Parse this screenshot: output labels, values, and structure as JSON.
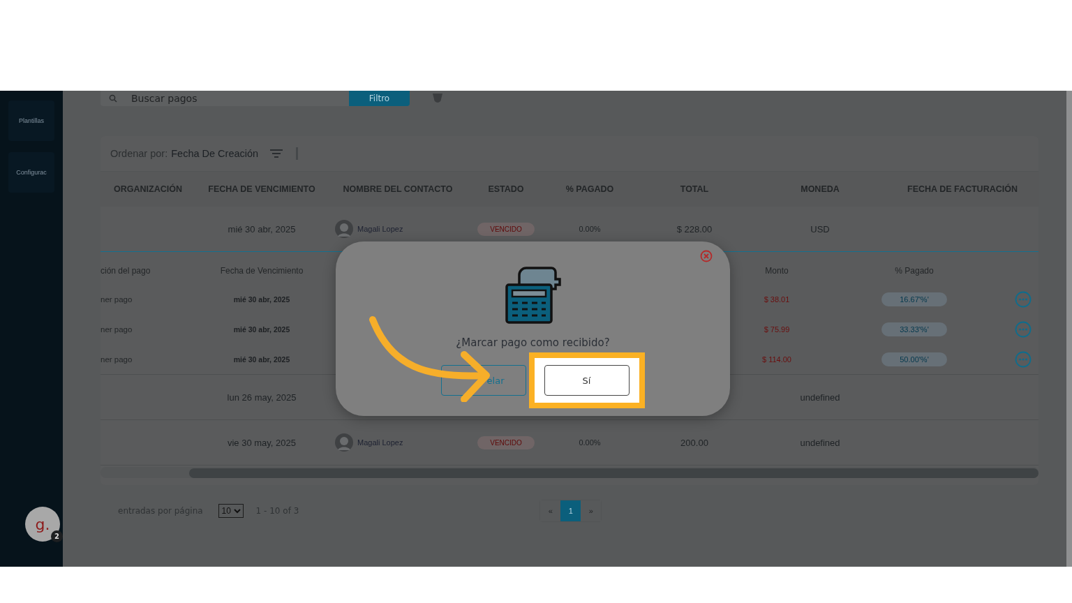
{
  "sidebar": {
    "items": [
      {
        "label": "Plantillas"
      },
      {
        "label": "Configurac"
      }
    ],
    "account": {
      "initial": "g.",
      "badge": "2"
    }
  },
  "toolbar": {
    "search": {
      "placeholder": "Buscar pagos"
    },
    "filter_button": "Filtro"
  },
  "sort": {
    "label": "Ordenar por:",
    "value": "Fecha De Creación"
  },
  "table": {
    "columns": [
      "ORGANIZACIÓN",
      "FECHA DE VENCIMIENTO",
      "NOMBRE DEL CONTACTO",
      "ESTADO",
      "% PAGADO",
      "TOTAL",
      "MONEDA",
      "FECHA DE FACTURACIÓN"
    ],
    "rows": [
      {
        "due": "mié 30 abr, 2025",
        "contact": "Magali Lopez",
        "status": "VENCIDO",
        "paid": "0.00%",
        "total": "$ 228.00",
        "currency": "USD",
        "expanded": true,
        "payments": {
          "columns": [
            "ción del pago",
            "Fecha de Vencimiento",
            "Monto",
            "% Pagado"
          ],
          "rows": [
            {
              "description": "ner pago",
              "due": "mié 30 abr, 2025",
              "amount": "$ 38.01",
              "percent": "16.67'%'"
            },
            {
              "description": "ner pago",
              "due": "mié 30 abr, 2025",
              "amount": "$ 75.99",
              "percent": "33.33'%'"
            },
            {
              "description": "ner pago",
              "due": "mié 30 abr, 2025",
              "amount": "$ 114.00",
              "percent": "50.00'%'"
            }
          ]
        }
      },
      {
        "due": "lun 26 may, 2025",
        "currency": "undefined",
        "expanded": false
      },
      {
        "due": "vie 30 may, 2025",
        "contact": "Magali Lopez",
        "status": "VENCIDO",
        "paid": "0.00%",
        "total": "200.00",
        "currency": "undefined",
        "expanded": false
      }
    ]
  },
  "pagination": {
    "label": "entradas por página",
    "page_size": "10",
    "range": "1 - 10 of 3",
    "pages": [
      {
        "label": "«",
        "selected": false
      },
      {
        "label": "1",
        "selected": true
      },
      {
        "label": "»",
        "selected": false
      }
    ]
  },
  "modal": {
    "question": "¿Marcar pago como recibido?",
    "buttons": [
      {
        "label": "elar",
        "kind": "secondary",
        "highlighted": false
      },
      {
        "label": "Sí",
        "kind": "primary",
        "highlighted": true
      }
    ]
  }
}
